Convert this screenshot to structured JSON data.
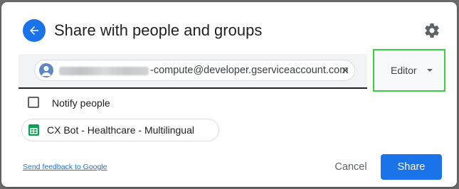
{
  "dialog": {
    "title": "Share with people and groups"
  },
  "recipient": {
    "email_suffix": "-compute@developer.gserviceaccount.com",
    "role": "Editor"
  },
  "notify": {
    "label": "Notify people",
    "checked": false
  },
  "file": {
    "name": "CX Bot - Healthcare - Multilingual"
  },
  "footer": {
    "feedback_link": "Send feedback to Google",
    "cancel_label": "Cancel",
    "share_label": "Share"
  },
  "colors": {
    "accent": "#1a73e8",
    "highlight": "#3ccf3c",
    "sheets": "#0f9d58"
  },
  "icons": {
    "back": "arrow-back-icon",
    "settings": "gear-icon",
    "avatar": "person-avatar-icon",
    "remove": "close-icon",
    "dropdown": "caret-down-icon",
    "file": "google-sheets-icon"
  }
}
